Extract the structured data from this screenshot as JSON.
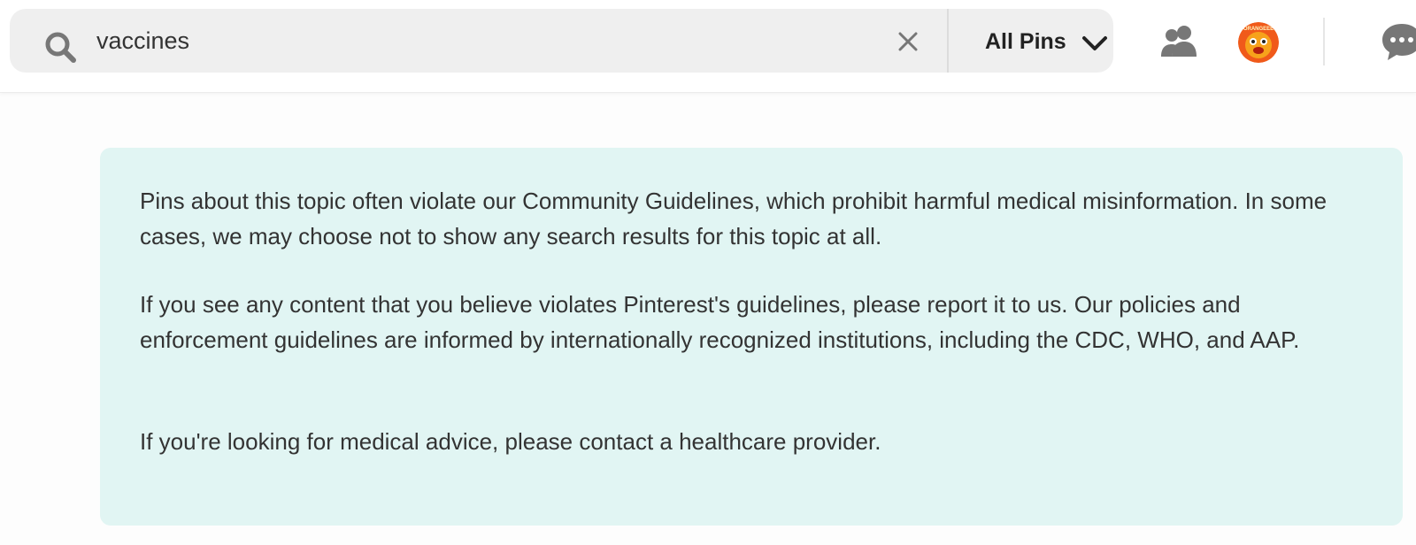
{
  "search": {
    "value": "vaccines",
    "placeholder": "Search"
  },
  "filter": {
    "label": "All Pins"
  },
  "avatar": {
    "label": "ORANGEEE"
  },
  "icons": {
    "search": "search-icon",
    "clear": "close-icon",
    "dropdown": "chevron-down-icon",
    "people": "people-icon",
    "messages": "chat-bubble-icon"
  },
  "colors": {
    "notice_background": "#e1f5f3",
    "search_background": "#efefef",
    "icon_gray": "#777777",
    "avatar_orange": "#f05a1a"
  },
  "notice": {
    "paragraphs": [
      "Pins about this topic often violate our Community Guidelines, which prohibit harmful medical misinformation. In some cases, we may choose not to show any search results for this topic at all.",
      "If you see any content that you believe violates Pinterest's guidelines, please report it to us. Our policies and enforcement guidelines are informed by internationally recognized institutions, including the CDC, WHO, and AAP.",
      "If you're looking for medical advice, please contact a healthcare provider."
    ]
  }
}
